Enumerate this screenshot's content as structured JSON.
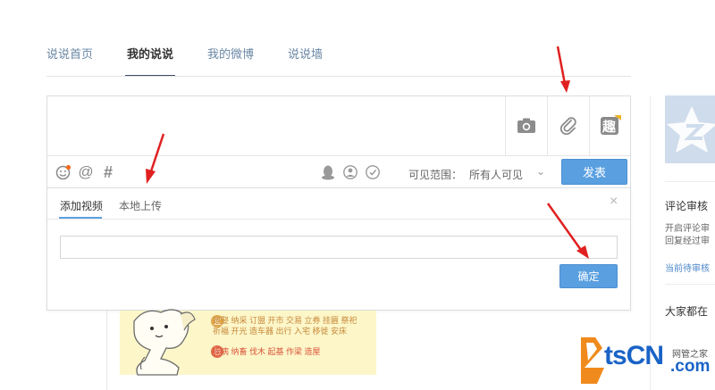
{
  "tabs": [
    {
      "label": "说说首页"
    },
    {
      "label": "我的说说"
    },
    {
      "label": "我的微博"
    },
    {
      "label": "说说墙"
    }
  ],
  "composer": {
    "text_value": "",
    "media_icons": [
      "camera-icon",
      "paperclip-icon",
      "qu-icon"
    ],
    "qu_label": "趣",
    "toolbar_icons": [
      "emoji-icon",
      "at-icon",
      "hashtag-icon",
      "qq-penguin-icon",
      "friend-icon",
      "timer-icon"
    ],
    "at_symbol": "@",
    "hash_symbol": "#",
    "visibility_label": "可见范围：",
    "visibility_value": "所有人可见",
    "publish_label": "发表"
  },
  "video_panel": {
    "tab_add_video": "添加视频",
    "tab_local_upload": "本地上传",
    "close_symbol": "×",
    "url_value": "",
    "confirm_label": "确定"
  },
  "almanac": {
    "yi_badge": "宜",
    "yi_lines": [
      "嫁娶 纳采 订盟 开市 交易 立券 挂匾 祭祀",
      "祈福 开光 造车器 出行 入宅 移徙 安床"
    ],
    "ji_badge": "忌",
    "ji_line": "探病 纳畜 伐木 起基 作梁 造屋"
  },
  "sidebar": {
    "review_title": "评论审核",
    "review_text_1": "开启评论审",
    "review_text_2": "回复经过审",
    "review_link": "当前待审核",
    "everyone_title": "大家都在"
  },
  "watermark": {
    "brand_main": "tsCN",
    "brand_com": ".com",
    "brand_sub": "网管之家"
  },
  "colors": {
    "accent_blue": "#5aa0e0",
    "tab_link": "#6a87a5",
    "arrow_red": "#e02020",
    "almanac_bg": "#fcf6c9"
  }
}
